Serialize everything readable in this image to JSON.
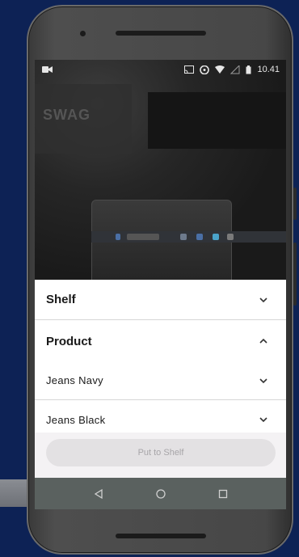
{
  "status_bar": {
    "time": "10.41",
    "icons": [
      "video-camera-icon",
      "cast-icon",
      "alarm-icon",
      "wifi-icon",
      "signal-icon",
      "battery-icon"
    ]
  },
  "camera_view": {
    "wall_text": "SWAG"
  },
  "sheet": {
    "shelf": {
      "label": "Shelf",
      "state": "collapsed"
    },
    "product": {
      "label": "Product",
      "state": "expanded"
    },
    "items": [
      {
        "label": "Jeans Navy"
      },
      {
        "label": "Jeans Black"
      }
    ],
    "put_to_shelf_label": "Put to Shelf"
  },
  "nav": {
    "icons": [
      "back-icon",
      "home-icon",
      "recents-icon"
    ]
  },
  "colors": {
    "background": "#0d2255",
    "button_disabled": "#e3e1e3",
    "nav_bar": "#5a615f"
  }
}
